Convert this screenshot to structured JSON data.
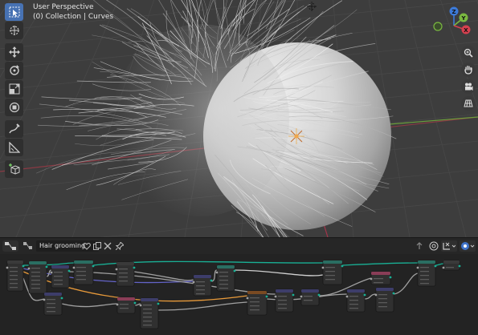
{
  "viewport": {
    "title": "User Perspective",
    "subtitle": "(0) Collection | Curves",
    "axis_colors": {
      "x": "#d6404f",
      "y": "#7ab940",
      "z": "#3c7ad8"
    },
    "gizmo_labels": {
      "x": "X",
      "y": "Y",
      "z": "Z"
    }
  },
  "toolbar": {
    "tools": [
      {
        "name": "select-box-icon",
        "active": true
      },
      {
        "name": "cursor-icon",
        "active": false
      },
      {
        "name": "move-icon",
        "active": false
      },
      {
        "name": "rotate-icon",
        "active": false
      },
      {
        "name": "scale-icon",
        "active": false
      },
      {
        "name": "transform-icon",
        "active": false
      },
      {
        "name": "annotate-icon",
        "active": false
      },
      {
        "name": "measure-icon",
        "active": false
      },
      {
        "name": "add-cube-icon",
        "active": false
      }
    ]
  },
  "navigation": {
    "buttons": [
      "zoom-icon",
      "pan-hand-icon",
      "camera-icon",
      "grid-perspective-icon"
    ]
  },
  "node_editor": {
    "tree_name": "Hair grooming",
    "header_icons": [
      "geometry-nodes-icon",
      "fake-user-icon",
      "duplicate-icon",
      "delete-icon",
      "pin-icon",
      "parent-icon",
      "overlay-icon",
      "snap-icon",
      "gizmo-icon"
    ],
    "link_colors": {
      "geometry": "#19b095",
      "float": "#a1a1a1",
      "vector": "#6363c7",
      "orange": "#e89a3a",
      "white": "#d0d0d0"
    }
  }
}
